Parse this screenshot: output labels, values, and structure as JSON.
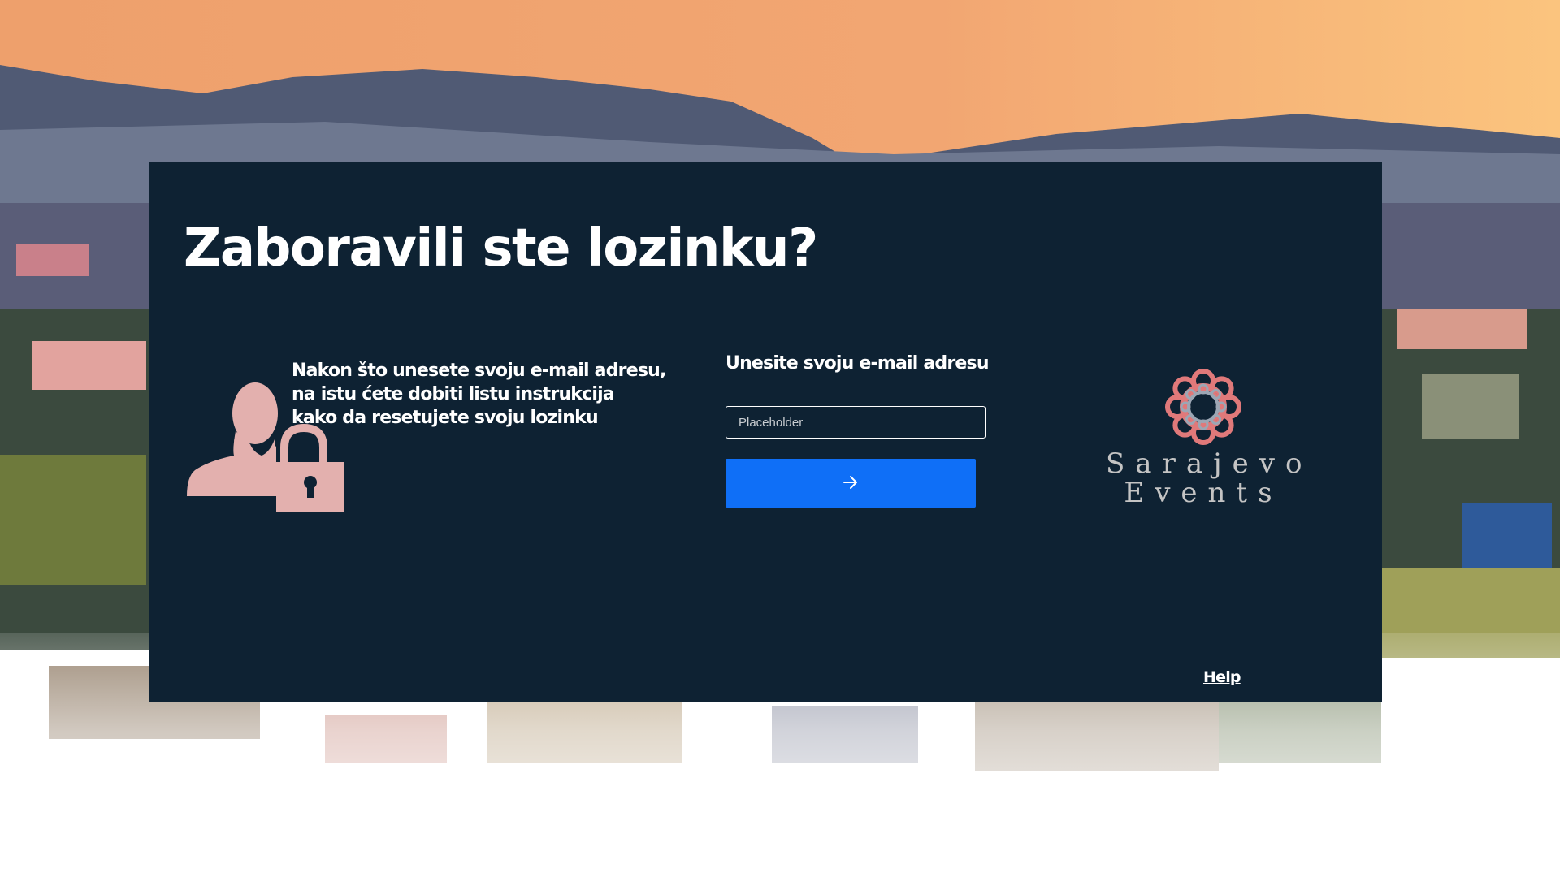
{
  "page": {
    "title": "Zaboravili ste lozinku?",
    "info_lines": [
      "Nakon što unesete svoju e-mail adresu,",
      "na istu ćete dobiti listu instrukcija",
      "kako da resetujete svoju lozinku"
    ]
  },
  "form": {
    "label": "Unesite svoju e-mail adresu",
    "email_value": "",
    "email_placeholder": "Placeholder",
    "submit_icon": "arrow-right-icon"
  },
  "logo": {
    "line1": "Sarajevo",
    "line2": "Events",
    "icon": "knot-ornament-icon"
  },
  "footer": {
    "help_label": "Help"
  },
  "colors": {
    "card_bg": "#0e2233",
    "accent_blue": "#0f6ff7",
    "illustration_pink": "#e3b0ae",
    "logo_rose": "#e0797a",
    "sky_orange": "#f2a874",
    "mountain": "#4f5a72"
  }
}
